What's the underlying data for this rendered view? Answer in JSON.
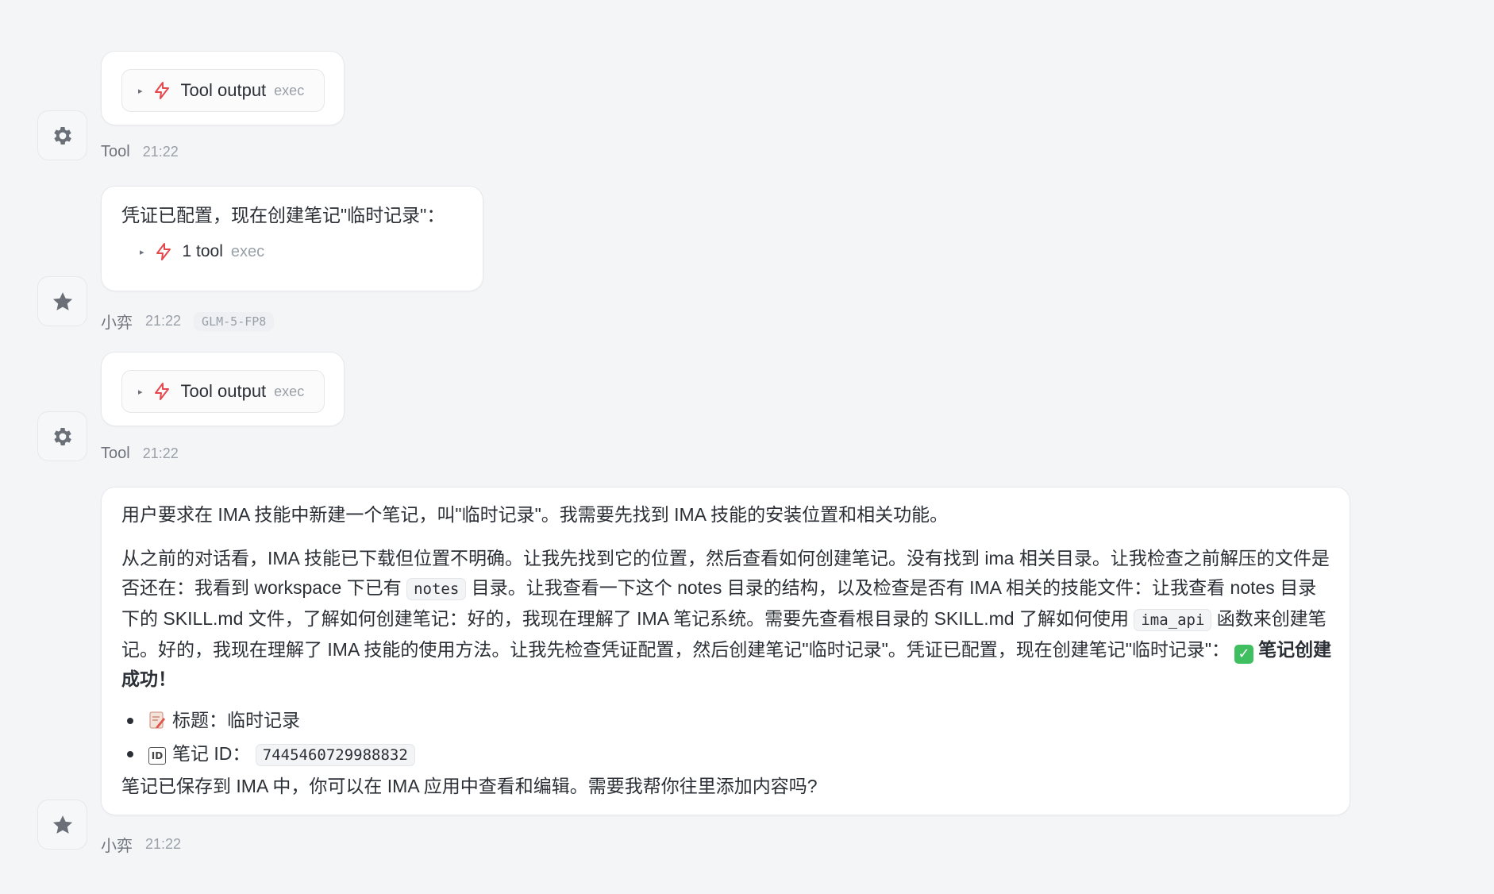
{
  "messages": [
    {
      "role": "tool",
      "tool_chip": {
        "label": "Tool output",
        "sub": "exec"
      },
      "author": "Tool",
      "time": "21:22"
    },
    {
      "role": "assistant",
      "text": "凭证已配置，现在创建笔记\"临时记录\"：",
      "tool_chip": {
        "label": "1 tool",
        "sub": "exec"
      },
      "author": "小弈",
      "time": "21:22",
      "model": "GLM-5-FP8"
    },
    {
      "role": "tool",
      "tool_chip": {
        "label": "Tool output",
        "sub": "exec"
      },
      "author": "Tool",
      "time": "21:22"
    },
    {
      "role": "assistant",
      "para1": "用户要求在 IMA 技能中新建一个笔记，叫\"临时记录\"。我需要先找到 IMA 技能的安装位置和相关功能。",
      "para2": {
        "a": "从之前的对话看，IMA 技能已下载但位置不明确。让我先找到它的位置，然后查看如何创建笔记。没有找到 ima 相关目录。让我检查之前解压的文件是否还在：我看到 workspace 下已有 ",
        "code1": "notes",
        "b": " 目录。让我查看一下这个 notes 目录的结构，以及检查是否有 IMA 相关的技能文件：让我查看 notes 目录下的 SKILL.md 文件，了解如何创建笔记：好的，我现在理解了 IMA 笔记系统。需要先查看根目录的 SKILL.md 了解如何使用 ",
        "code2": "ima_api",
        "c": " 函数来创建笔记。好的，我现在理解了 IMA 技能的使用方法。让我先检查凭证配置，然后创建笔记\"临时记录\"。凭证已配置，现在创建笔记\"临时记录\"：",
        "success": "笔记创建成功！"
      },
      "list": {
        "title_label": "标题：临时记录",
        "id_label": "笔记 ID：",
        "id_value": "7445460729988832"
      },
      "footer": "笔记已保存到 IMA 中，你可以在 IMA 应用中查看和编辑。需要我帮你往里添加内容吗?",
      "author": "小弈",
      "time": "21:22"
    }
  ],
  "icons": {
    "tool_avatar": "gear-icon",
    "assistant_avatar": "star-icon",
    "tool_chip": "lightning-icon",
    "success": "check-mark-icon",
    "title_bullet": "memo-icon",
    "id_bullet": "id-icon"
  },
  "colors": {
    "lightning": "#e5484d",
    "check": "#3fbf5f"
  }
}
